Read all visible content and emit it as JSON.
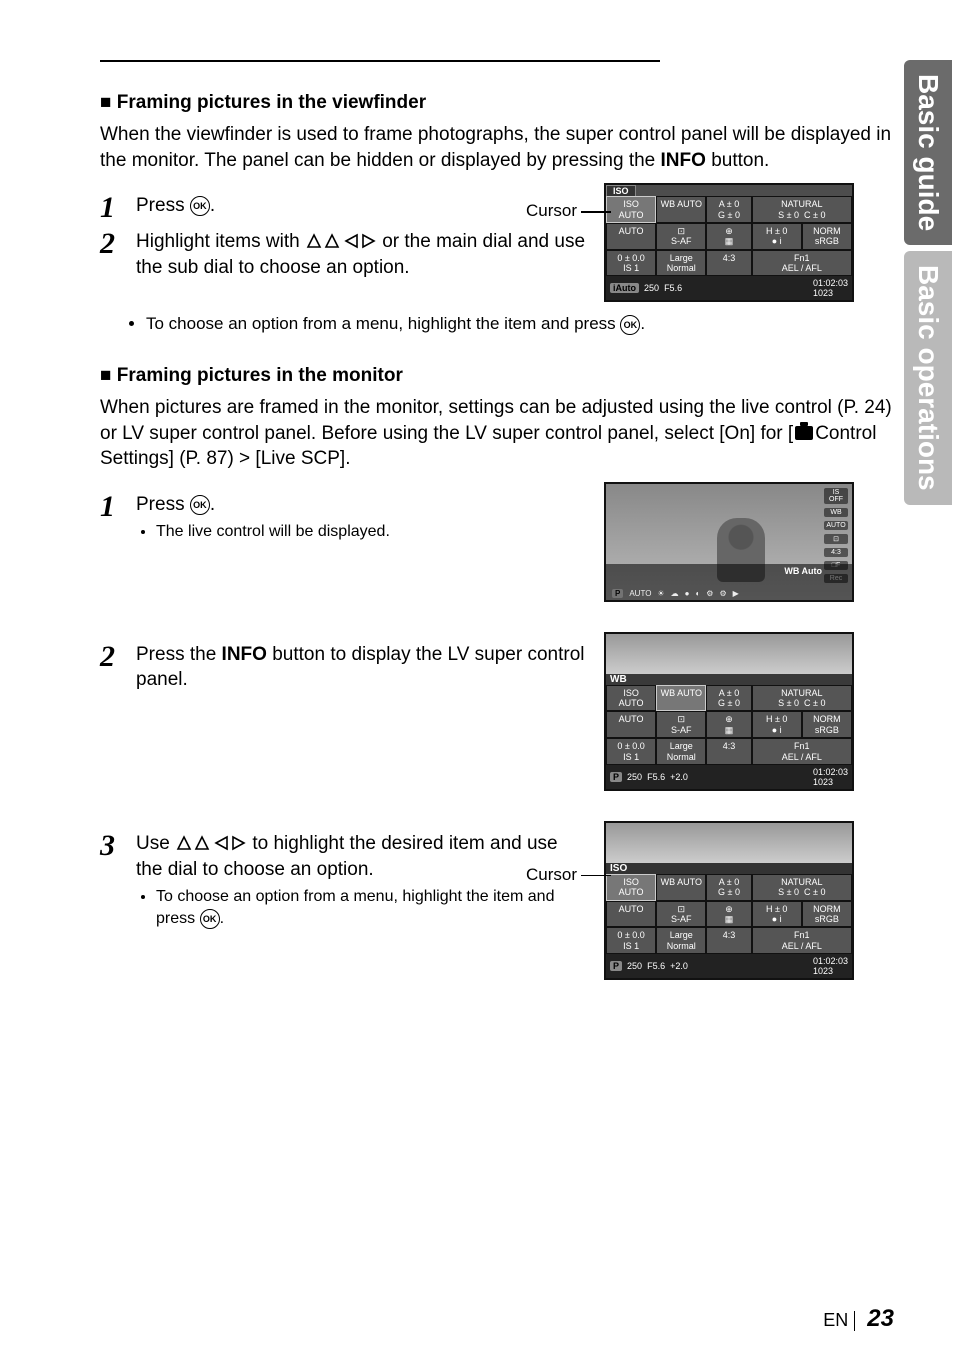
{
  "sideTabs": {
    "tab1": "Basic guide",
    "tab2": "Basic operations"
  },
  "section1": {
    "square": "■",
    "heading": "Framing pictures in the viewfinder",
    "para": "When the viewfinder is used to frame photographs, the super control panel will be displayed in the monitor. The panel can be hidden or displayed by pressing the ",
    "info": "INFO",
    "paraTail": " button.",
    "step1": "Press ",
    "step1post": ".",
    "step2a": "Highlight items with ",
    "step2b": " or the main dial and use the sub dial to choose an option.",
    "note": "To choose an option from a menu, highlight the item and press ",
    "notePost": "."
  },
  "section2": {
    "square": "■",
    "heading": "Framing pictures in the monitor",
    "para": "When pictures are framed in the monitor, settings can be adjusted using the live control (P. 24) or LV super control panel. Before using the LV super control panel, select [On] for [",
    "paraMid": "Control Settings] (P. 87) > [Live SCP].",
    "step1": "Press ",
    "step1post": ".",
    "step1bullet": "The live control will be displayed.",
    "step2a": "Press the ",
    "step2info": "INFO",
    "step2b": " button to display the LV super control panel.",
    "step3a": "Use ",
    "step3b": " to highlight the desired item and use the dial to choose an option.",
    "step3bullet1": "To choose an option from a menu, highlight the item and press ",
    "step3bullet1post": "."
  },
  "labels": {
    "cursor": "Cursor",
    "ok": "OK"
  },
  "lcd": {
    "tab": "ISO",
    "isoAuto": "ISO\nAUTO",
    "wbAuto": "WB\nAUTO",
    "a0": "A ± 0",
    "g0": "G ± 0",
    "natural": "NATURAL",
    "s0": "S ± 0",
    "c0": "C ± 0",
    "flashAuto": "AUTO",
    "saf": "S-AF",
    "point": "⊡",
    "grid": "▦",
    "h0": "H ± 0",
    "norm": "NORM",
    "zero": "0 ± 0.0",
    "large": "Large",
    "normal": "Normal",
    "i43": "4:3",
    "circle": "● i",
    "srgb": "sRGB",
    "is1": "IS 1",
    "fn1": "Fn1",
    "ael": "AEL / AFL",
    "mode": "iAuto",
    "modeP": "P",
    "shutter": "250",
    "fstop": "F5.6",
    "exp": "+2.0",
    "time": "01:02:03",
    "shots": "1023"
  },
  "livebar": {
    "title": "WB Auto",
    "auto": "AUTO",
    "side": [
      "IS OFF",
      "WB",
      "AUTO",
      "⊡",
      "4:3",
      "□F",
      "Rec"
    ],
    "panelLabel": "WB"
  },
  "footer": {
    "lang": "EN",
    "page": "23"
  }
}
